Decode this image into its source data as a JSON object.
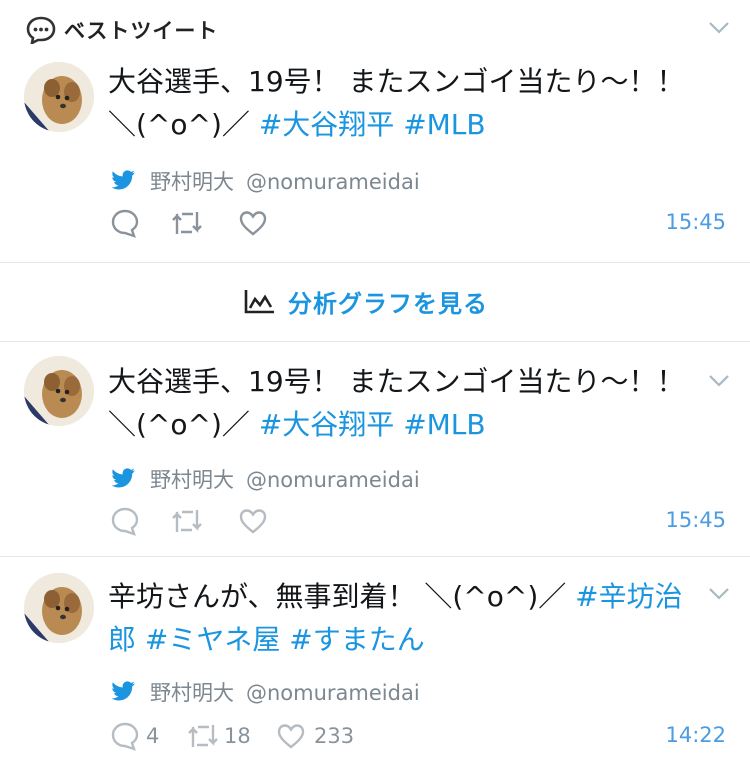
{
  "header": {
    "title": "ベストツイート"
  },
  "analytics": {
    "label": "分析グラフを見る"
  },
  "tweets": [
    {
      "text_plain": "大谷選手、19号！ またスンゴイ当たり〜！！ ＼(^o^)／ ",
      "hashtags": [
        "#大谷翔平",
        "#MLB"
      ],
      "author_name": "野村明大",
      "author_handle": "@nomurameidai",
      "reply_count": "",
      "retweet_count": "",
      "like_count": "",
      "time": "15:45"
    },
    {
      "text_plain": "大谷選手、19号！ またスンゴイ当たり〜！！ ＼(^o^)／ ",
      "hashtags": [
        "#大谷翔平",
        "#MLB"
      ],
      "author_name": "野村明大",
      "author_handle": "@nomurameidai",
      "reply_count": "",
      "retweet_count": "",
      "like_count": "",
      "time": "15:45"
    },
    {
      "text_plain": "辛坊さんが、無事到着！ ＼(^o^)／ ",
      "hashtags": [
        "#辛坊治郎",
        "#ミヤネ屋",
        "#すまたん"
      ],
      "author_name": "野村明大",
      "author_handle": "@nomurameidai",
      "reply_count": "4",
      "retweet_count": "18",
      "like_count": "233",
      "time": "14:22"
    }
  ],
  "colors": {
    "link": "#1b95e0",
    "muted": "#7d8790",
    "divider": "#e1e8ed"
  }
}
